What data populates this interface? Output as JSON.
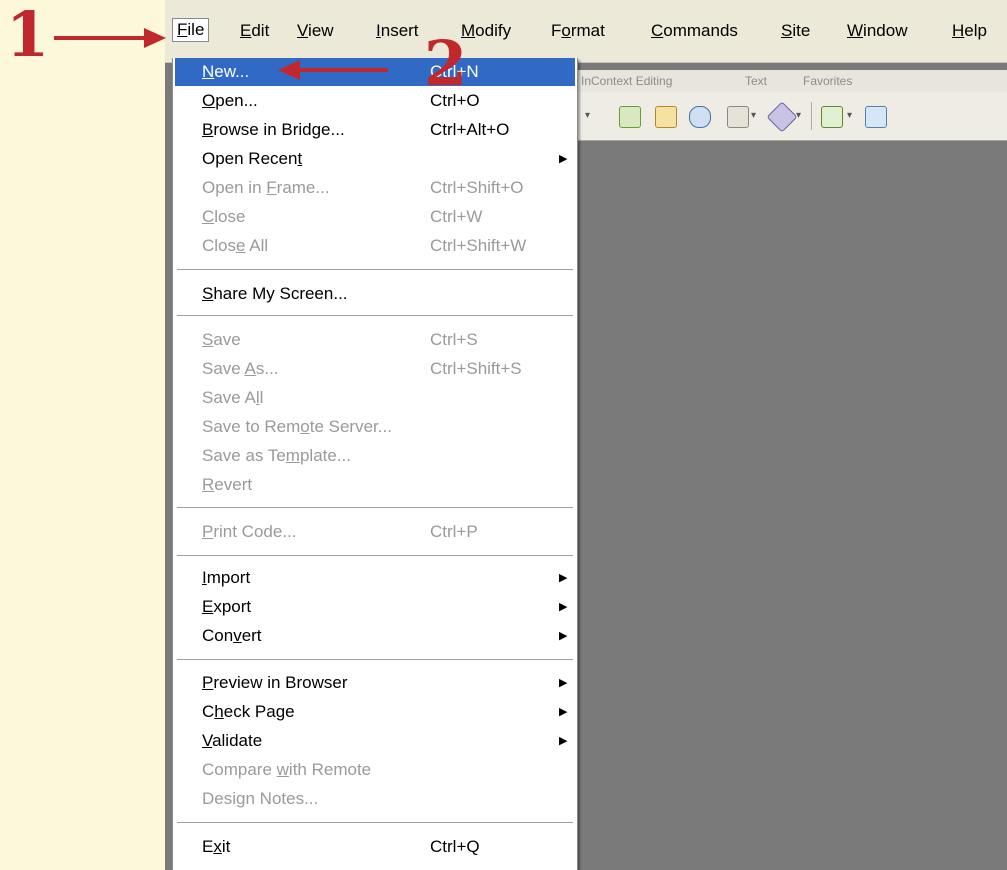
{
  "menubar": {
    "items": [
      {
        "pre": "",
        "key": "F",
        "post": "ile"
      },
      {
        "pre": "",
        "key": "E",
        "post": "dit"
      },
      {
        "pre": "",
        "key": "V",
        "post": "iew"
      },
      {
        "pre": "",
        "key": "I",
        "post": "nsert"
      },
      {
        "pre": "",
        "key": "M",
        "post": "odify"
      },
      {
        "pre": "F",
        "key": "o",
        "post": "rmat"
      },
      {
        "pre": "",
        "key": "C",
        "post": "ommands"
      },
      {
        "pre": "",
        "key": "S",
        "post": "ite"
      },
      {
        "pre": "",
        "key": "W",
        "post": "indow"
      },
      {
        "pre": "",
        "key": "H",
        "post": "elp"
      }
    ]
  },
  "insertbar": {
    "tabs": [
      "InContext Editing",
      "Text",
      "Favorites"
    ]
  },
  "file_menu": {
    "items": [
      {
        "pre": "",
        "key": "N",
        "post": "ew...",
        "shortcut": "Ctrl+N"
      },
      {
        "pre": "",
        "key": "O",
        "post": "pen...",
        "shortcut": "Ctrl+O"
      },
      {
        "pre": "",
        "key": "B",
        "post": "rowse in Bridge...",
        "shortcut": "Ctrl+Alt+O"
      },
      {
        "pre": "Open Recen",
        "key": "t",
        "post": "",
        "shortcut": ""
      },
      {
        "pre": "Open in ",
        "key": "F",
        "post": "rame...",
        "shortcut": "Ctrl+Shift+O"
      },
      {
        "pre": "",
        "key": "C",
        "post": "lose",
        "shortcut": "Ctrl+W"
      },
      {
        "pre": "Clos",
        "key": "e",
        "post": " All",
        "shortcut": "Ctrl+Shift+W"
      },
      {
        "pre": "",
        "key": "S",
        "post": "hare My Screen...",
        "shortcut": ""
      },
      {
        "pre": "",
        "key": "S",
        "post": "ave",
        "shortcut": "Ctrl+S"
      },
      {
        "pre": "Save ",
        "key": "A",
        "post": "s...",
        "shortcut": "Ctrl+Shift+S"
      },
      {
        "pre": "Save A",
        "key": "l",
        "post": "l",
        "shortcut": ""
      },
      {
        "pre": "Save to Rem",
        "key": "o",
        "post": "te Server...",
        "shortcut": ""
      },
      {
        "pre": "Save as Te",
        "key": "m",
        "post": "plate...",
        "shortcut": ""
      },
      {
        "pre": "",
        "key": "R",
        "post": "evert",
        "shortcut": ""
      },
      {
        "pre": "",
        "key": "P",
        "post": "rint Code...",
        "shortcut": "Ctrl+P"
      },
      {
        "pre": "",
        "key": "I",
        "post": "mport",
        "shortcut": ""
      },
      {
        "pre": "",
        "key": "E",
        "post": "xport",
        "shortcut": ""
      },
      {
        "pre": "Con",
        "key": "v",
        "post": "ert",
        "shortcut": ""
      },
      {
        "pre": "",
        "key": "P",
        "post": "review in Browser",
        "shortcut": ""
      },
      {
        "pre": "C",
        "key": "h",
        "post": "eck Page",
        "shortcut": ""
      },
      {
        "pre": "",
        "key": "V",
        "post": "alidate",
        "shortcut": ""
      },
      {
        "pre": "Compare ",
        "key": "w",
        "post": "ith Remote",
        "shortcut": ""
      },
      {
        "pre": "Desi",
        "key": "g",
        "post": "n Notes...",
        "shortcut": ""
      },
      {
        "pre": "E",
        "key": "x",
        "post": "it",
        "shortcut": "Ctrl+Q"
      }
    ]
  },
  "annotations": {
    "step1": "1",
    "step2": "2"
  },
  "colors": {
    "annotation": "#c0282d",
    "highlight": "#316ac5",
    "background": "#fdf8d9"
  }
}
